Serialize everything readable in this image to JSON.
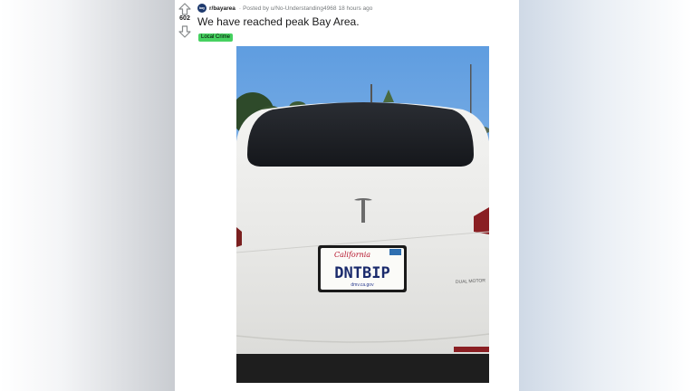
{
  "post": {
    "score": "602",
    "subreddit": "r/bayarea",
    "subreddit_icon_text": "bay",
    "posted_by": "Posted by u/No-Understanding4968",
    "time_ago": "18 hours ago",
    "title": "We have reached peak Bay Area.",
    "flair": "Local Crime",
    "flair_color": "#46d160"
  },
  "photo": {
    "plate_state": "California",
    "plate_text": "DNTBIP",
    "plate_website": "dmv.ca.gov",
    "badge_text": "DUAL MOTOR"
  },
  "icons": {
    "upvote": "upvote-arrow-icon",
    "downvote": "downvote-arrow-icon"
  }
}
